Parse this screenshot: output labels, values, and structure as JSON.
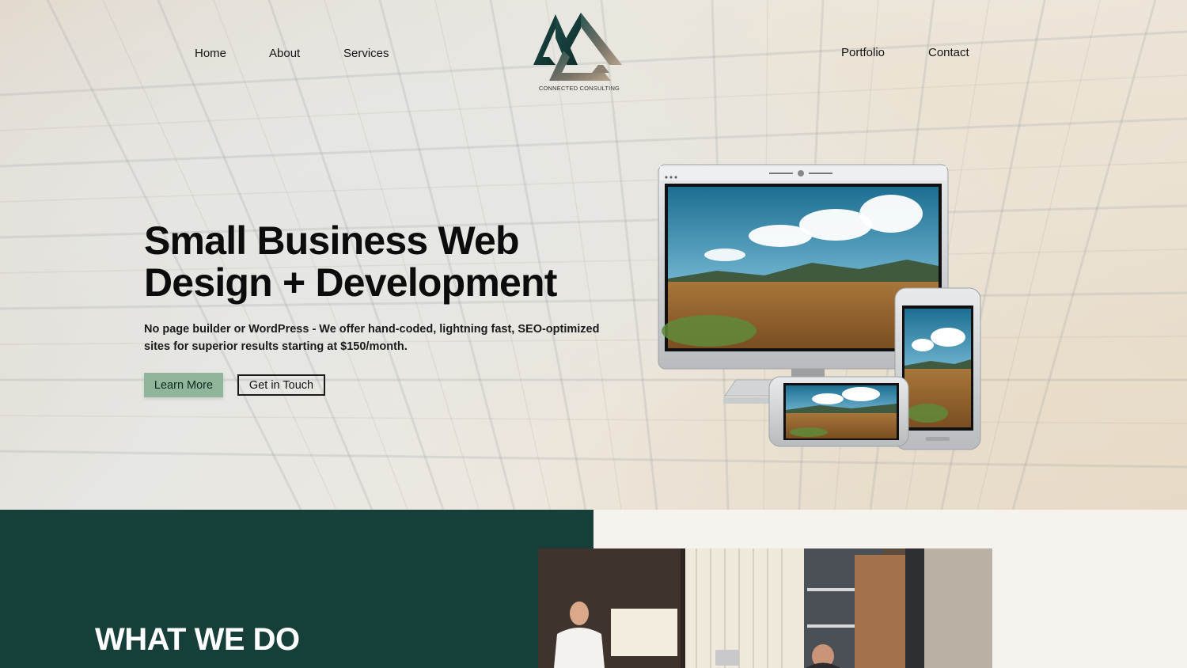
{
  "nav": {
    "left": [
      "Home",
      "About",
      "Services"
    ],
    "right": [
      "Portfolio",
      "Contact"
    ]
  },
  "logo": {
    "text": "CONNECTED CONSULTING"
  },
  "hero": {
    "headline_line1": "Small Business Web",
    "headline_line2": "Design + Development",
    "subtext": "No page builder or WordPress - We offer hand-coded, lightning fast, SEO-optimized sites for superior results starting at $150/month.",
    "primary_button": "Learn More",
    "secondary_button": "Get in Touch",
    "devices_image": "responsive-devices-mockup"
  },
  "section": {
    "title": "WHAT WE DO",
    "photo": "office-meeting-photo"
  },
  "colors": {
    "accent_green": "#8fb59a",
    "dark_teal": "#173f3a",
    "cream": "#f6f3ef",
    "logo_teal": "#1e4a47"
  },
  "icons": [
    "triangle-logo-icon"
  ]
}
